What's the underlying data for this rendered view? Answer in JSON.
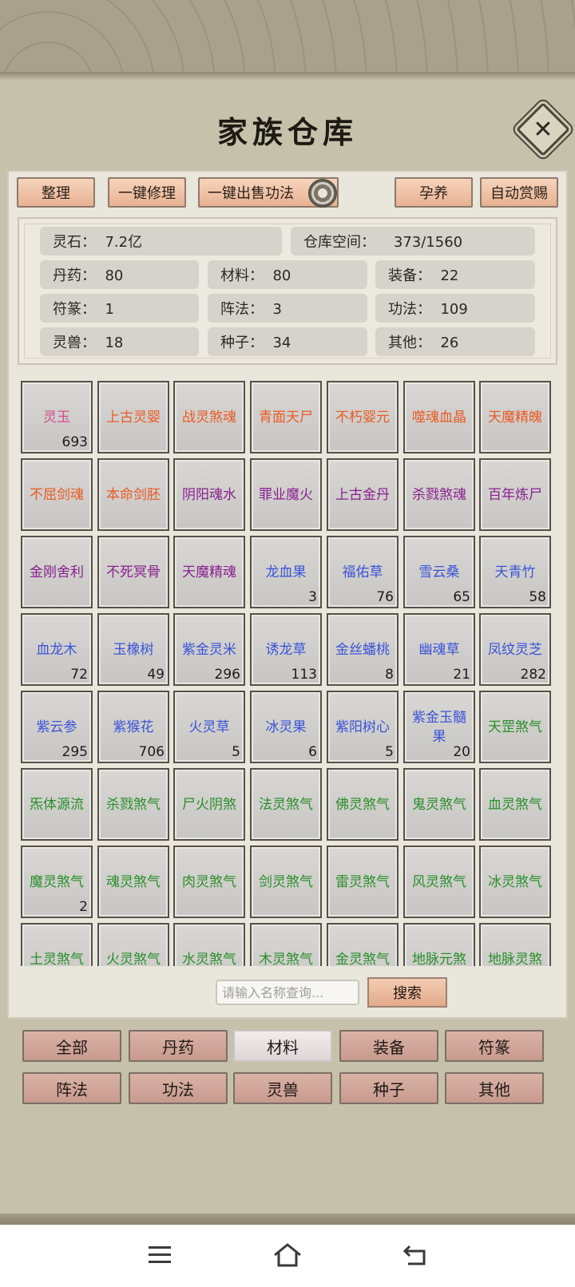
{
  "title": "家族仓库",
  "toolbar": {
    "sort": "整理",
    "repair_all": "一键修理",
    "sell_skills": "一键出售功法",
    "nurture": "孕养",
    "auto_reward": "自动赏赐",
    "settings_icon": "gear-icon"
  },
  "stats": {
    "spirit_stone": "灵石：  7.2亿",
    "capacity": "仓库空间：    373/1560",
    "pills": "丹药：  80",
    "materials": "材料：  80",
    "equipment": "装备：  22",
    "talismans": "符篆：  1",
    "formations": "阵法：  3",
    "skills": "功法：  109",
    "beasts": "灵兽：  18",
    "seeds": "种子：  34",
    "others": "其他：  26"
  },
  "colors": {
    "pink": "#d44a8f",
    "orange": "#ea5a24",
    "purple": "#8a1f8f",
    "blue": "#3a53d9",
    "green": "#2a8f2a"
  },
  "items": [
    {
      "name": "灵玉",
      "count": "693",
      "color": "pink"
    },
    {
      "name": "上古灵婴",
      "count": "",
      "color": "orange"
    },
    {
      "name": "战灵煞魂",
      "count": "",
      "color": "orange"
    },
    {
      "name": "青面天尸",
      "count": "",
      "color": "orange"
    },
    {
      "name": "不朽婴元",
      "count": "",
      "color": "orange"
    },
    {
      "name": "噬魂血晶",
      "count": "",
      "color": "orange"
    },
    {
      "name": "天魔精魄",
      "count": "",
      "color": "orange"
    },
    {
      "name": "不屈剑魂",
      "count": "",
      "color": "orange"
    },
    {
      "name": "本命剑胚",
      "count": "",
      "color": "orange"
    },
    {
      "name": "阴阳魂水",
      "count": "",
      "color": "purple"
    },
    {
      "name": "罪业魔火",
      "count": "",
      "color": "purple"
    },
    {
      "name": "上古金丹",
      "count": "",
      "color": "purple"
    },
    {
      "name": "杀戮煞魂",
      "count": "",
      "color": "purple"
    },
    {
      "name": "百年炼尸",
      "count": "",
      "color": "purple"
    },
    {
      "name": "金刚舍利",
      "count": "",
      "color": "purple"
    },
    {
      "name": "不死冥骨",
      "count": "",
      "color": "purple"
    },
    {
      "name": "天魔精魂",
      "count": "",
      "color": "purple"
    },
    {
      "name": "龙血果",
      "count": "3",
      "color": "blue"
    },
    {
      "name": "福佑草",
      "count": "76",
      "color": "blue"
    },
    {
      "name": "雪云桑",
      "count": "65",
      "color": "blue"
    },
    {
      "name": "天青竹",
      "count": "58",
      "color": "blue"
    },
    {
      "name": "血龙木",
      "count": "72",
      "color": "blue"
    },
    {
      "name": "玉橡树",
      "count": "49",
      "color": "blue"
    },
    {
      "name": "紫金灵米",
      "count": "296",
      "color": "blue"
    },
    {
      "name": "诱龙草",
      "count": "113",
      "color": "blue"
    },
    {
      "name": "金丝蟠桃",
      "count": "8",
      "color": "blue"
    },
    {
      "name": "幽魂草",
      "count": "21",
      "color": "blue"
    },
    {
      "name": "凤纹灵芝",
      "count": "282",
      "color": "blue"
    },
    {
      "name": "紫云参",
      "count": "295",
      "color": "blue"
    },
    {
      "name": "紫猴花",
      "count": "706",
      "color": "blue"
    },
    {
      "name": "火灵草",
      "count": "5",
      "color": "blue"
    },
    {
      "name": "冰灵果",
      "count": "6",
      "color": "blue"
    },
    {
      "name": "紫阳树心",
      "count": "5",
      "color": "blue"
    },
    {
      "name": "紫金玉髓果",
      "count": "20",
      "color": "blue"
    },
    {
      "name": "天罡煞气",
      "count": "",
      "color": "green"
    },
    {
      "name": "炁体源流",
      "count": "",
      "color": "green"
    },
    {
      "name": "杀戮煞气",
      "count": "",
      "color": "green"
    },
    {
      "name": "尸火阴煞",
      "count": "",
      "color": "green"
    },
    {
      "name": "法灵煞气",
      "count": "",
      "color": "green"
    },
    {
      "name": "佛灵煞气",
      "count": "",
      "color": "green"
    },
    {
      "name": "鬼灵煞气",
      "count": "",
      "color": "green"
    },
    {
      "name": "血灵煞气",
      "count": "",
      "color": "green"
    },
    {
      "name": "魔灵煞气",
      "count": "2",
      "color": "green"
    },
    {
      "name": "魂灵煞气",
      "count": "",
      "color": "green"
    },
    {
      "name": "肉灵煞气",
      "count": "",
      "color": "green"
    },
    {
      "name": "剑灵煞气",
      "count": "",
      "color": "green"
    },
    {
      "name": "雷灵煞气",
      "count": "",
      "color": "green"
    },
    {
      "name": "风灵煞气",
      "count": "",
      "color": "green"
    },
    {
      "name": "冰灵煞气",
      "count": "",
      "color": "green"
    },
    {
      "name": "土灵煞气",
      "count": "",
      "color": "green"
    },
    {
      "name": "火灵煞气",
      "count": "",
      "color": "green"
    },
    {
      "name": "水灵煞气",
      "count": "",
      "color": "green"
    },
    {
      "name": "木灵煞气",
      "count": "",
      "color": "green"
    },
    {
      "name": "金灵煞气",
      "count": "",
      "color": "green"
    },
    {
      "name": "地脉元煞",
      "count": "",
      "color": "green"
    },
    {
      "name": "地脉灵煞",
      "count": "",
      "color": "green"
    }
  ],
  "search": {
    "placeholder": "请输入名称查询...",
    "button": "搜索"
  },
  "categories": [
    "全部",
    "丹药",
    "材料",
    "装备",
    "符篆",
    "阵法",
    "功法",
    "灵兽",
    "种子",
    "其他"
  ],
  "active_category": "材料",
  "nav": {
    "menu_icon": "menu-icon",
    "home_icon": "home-icon",
    "back_icon": "back-icon"
  }
}
